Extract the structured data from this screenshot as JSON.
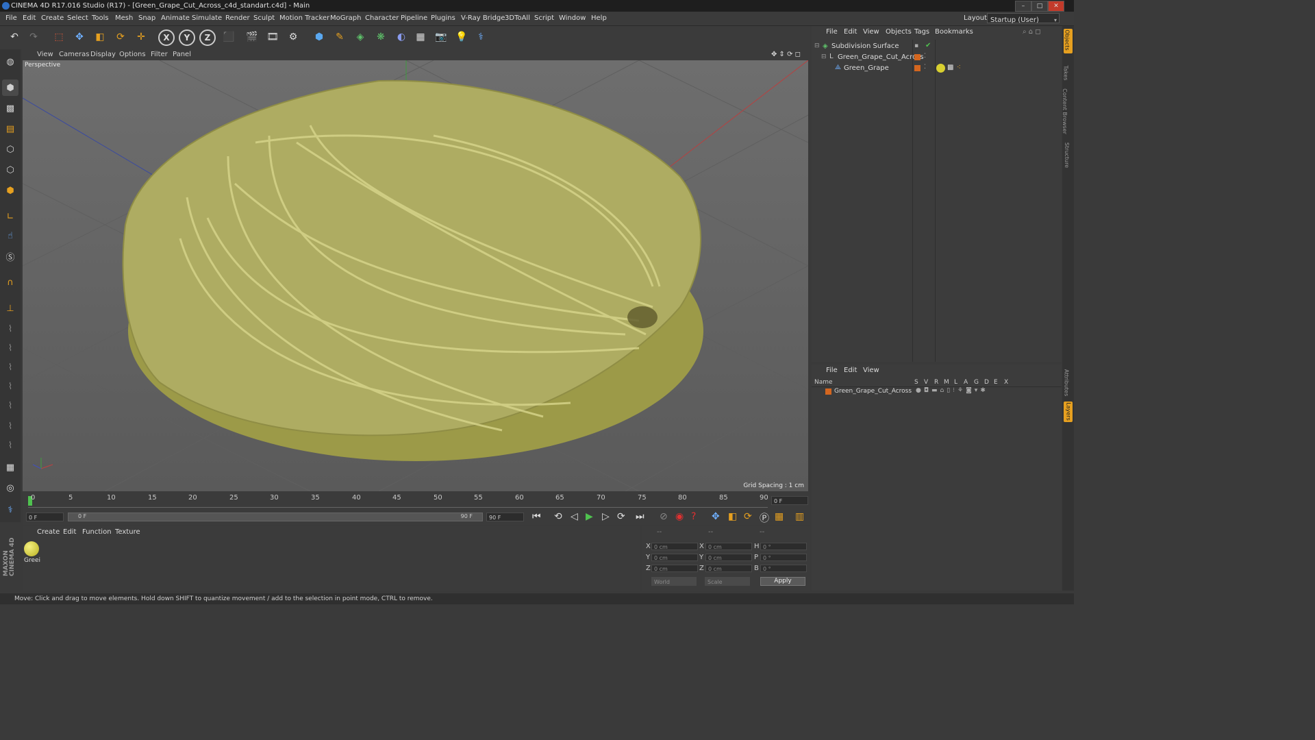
{
  "window": {
    "title": "CINEMA 4D R17.016 Studio (R17) - [Green_Grape_Cut_Across_c4d_standart.c4d] - Main",
    "layout_label": "Layout:",
    "layout_value": "Startup (User)"
  },
  "menubar": [
    "File",
    "Edit",
    "Create",
    "Select",
    "Tools",
    "Mesh",
    "Snap",
    "Animate",
    "Simulate",
    "Render",
    "Sculpt",
    "Motion Tracker",
    "MoGraph",
    "Character",
    "Pipeline",
    "Plugins",
    "V-Ray Bridge",
    "3DToAll",
    "Script",
    "Window",
    "Help"
  ],
  "toolbar": {
    "axis_x": "X",
    "axis_y": "Y",
    "axis_z": "Z"
  },
  "viewport": {
    "menu": [
      "View",
      "Cameras",
      "Display",
      "Options",
      "Filter",
      "Panel"
    ],
    "label": "Perspective",
    "grid_spacing": "Grid Spacing : 1 cm",
    "model_color": "#b2b05e"
  },
  "timeline": {
    "ticks": [
      "0",
      "5",
      "10",
      "15",
      "20",
      "25",
      "30",
      "35",
      "40",
      "45",
      "50",
      "55",
      "60",
      "65",
      "70",
      "75",
      "80",
      "85",
      "90"
    ],
    "current_frame": "0 F"
  },
  "transport": {
    "start_field": "0 F",
    "range_start": "0 F",
    "range_end": "90 F",
    "end_field": "90 F"
  },
  "material_manager": {
    "menu": [
      "Create",
      "Edit",
      "Function",
      "Texture"
    ],
    "material_label": "Greei"
  },
  "coords": {
    "header": [
      "--",
      "--",
      "--"
    ],
    "rows": [
      {
        "a": "X",
        "a_val": "0 cm",
        "b": "X",
        "b_val": "0 cm",
        "c": "H",
        "c_val": "0 °"
      },
      {
        "a": "Y",
        "a_val": "0 cm",
        "b": "Y",
        "b_val": "0 cm",
        "c": "P",
        "c_val": "0 °"
      },
      {
        "a": "Z",
        "a_val": "0 cm",
        "b": "Z",
        "b_val": "0 cm",
        "c": "B",
        "c_val": "0 °"
      }
    ],
    "world": "World",
    "scale": "Scale",
    "apply": "Apply"
  },
  "object_manager": {
    "menu": [
      "File",
      "Edit",
      "View",
      "Objects",
      "Tags",
      "Bookmarks"
    ],
    "objects": [
      {
        "name": "Subdivision Surface",
        "indent": 0
      },
      {
        "name": "Green_Grape_Cut_Across",
        "indent": 1
      },
      {
        "name": "Green_Grape",
        "indent": 2
      }
    ]
  },
  "layer_manager": {
    "menu": [
      "File",
      "Edit",
      "View"
    ],
    "columns": [
      "Name",
      "S",
      "V",
      "R",
      "M",
      "L",
      "A",
      "G",
      "D",
      "E",
      "X"
    ],
    "layers": [
      {
        "name": "Green_Grape_Cut_Across"
      }
    ]
  },
  "right_tabs": [
    "Objects",
    "Takes",
    "Content Browser",
    "Structure",
    "Attributes",
    "Layers"
  ],
  "status": "Move: Click and drag to move elements. Hold down SHIFT to quantize movement / add to the selection in point mode, CTRL to remove.",
  "brand": [
    "MAXON",
    "CINEMA 4D"
  ]
}
